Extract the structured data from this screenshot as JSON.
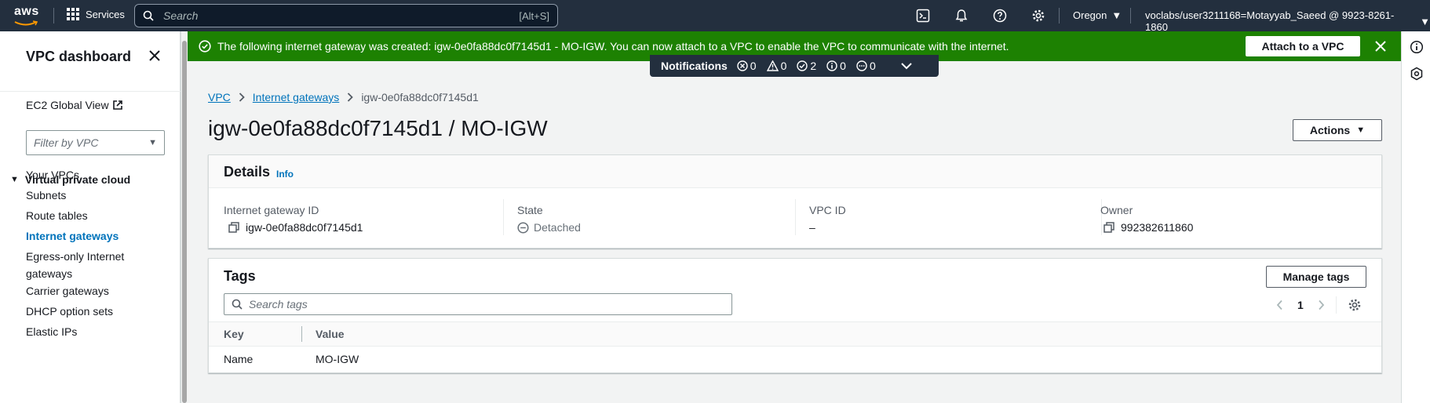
{
  "topnav": {
    "logo": "aws",
    "services_label": "Services",
    "search_placeholder": "Search",
    "search_shortcut": "[Alt+S]",
    "region": "Oregon",
    "account": "voclabs/user3211168=Motayyab_Saeed @ 9923-8261-1860",
    "icons": [
      "cloudshell-icon",
      "notifications-bell-icon",
      "help-icon",
      "settings-gear-icon"
    ]
  },
  "sidebar": {
    "title": "VPC dashboard",
    "global_view": "EC2 Global View",
    "filter_placeholder": "Filter by VPC",
    "section": "Virtual private cloud",
    "items": [
      "Your VPCs",
      "Subnets",
      "Route tables",
      "Internet gateways",
      "Egress-only Internet gateways",
      "Carrier gateways",
      "DHCP option sets",
      "Elastic IPs"
    ],
    "active_item": "Internet gateways"
  },
  "flash": {
    "message": "The following internet gateway was created: igw-0e0fa88dc0f7145d1 - MO-IGW. You can now attach to a VPC to enable the VPC to communicate with the internet.",
    "button": "Attach to a VPC",
    "color": "#1d8102"
  },
  "notifications": {
    "label": "Notifications",
    "error": "0",
    "warning": "0",
    "success": "2",
    "info": "0",
    "in_progress": "0"
  },
  "breadcrumb": {
    "root": "VPC",
    "parent": "Internet gateways",
    "current": "igw-0e0fa88dc0f7145d1"
  },
  "page": {
    "title": "igw-0e0fa88dc0f7145d1 / MO-IGW",
    "actions": "Actions"
  },
  "details": {
    "heading": "Details",
    "info": "Info",
    "gateway_id_label": "Internet gateway ID",
    "gateway_id": "igw-0e0fa88dc0f7145d1",
    "state_label": "State",
    "state": "Detached",
    "vpc_id_label": "VPC ID",
    "vpc_id": "–",
    "owner_label": "Owner",
    "owner": "992382611860"
  },
  "tags": {
    "heading": "Tags",
    "manage": "Manage tags",
    "search_placeholder": "Search tags",
    "page": "1",
    "col_key": "Key",
    "col_value": "Value",
    "rows": [
      {
        "key": "Name",
        "value": "MO-IGW"
      }
    ]
  }
}
